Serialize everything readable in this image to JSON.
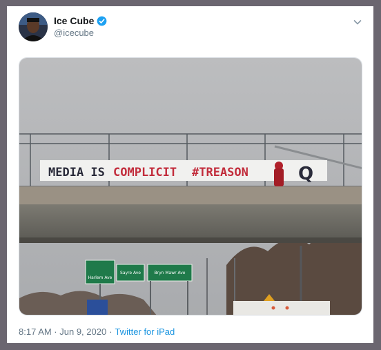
{
  "tweet": {
    "display_name": "Ice Cube",
    "handle": "@icecube",
    "verified": true,
    "timestamp": "8:17 AM · Jun 9, 2020",
    "separator": "·",
    "source": "Twitter for iPad"
  },
  "photo": {
    "banner_words": [
      "MEDIA IS",
      "COMPLICIT",
      "#TREASON",
      "Q"
    ],
    "signs": [
      "Harlem Ave",
      "Sayre Ave",
      "Bryn Mawr Ave"
    ]
  },
  "colors": {
    "verified_badge": "#1da1f2",
    "link": "#1b95e0",
    "secondary_text": "#657786",
    "frame": "#6b6670"
  },
  "icons": {
    "verified": "verified-badge-icon",
    "caret": "chevron-down-icon"
  }
}
